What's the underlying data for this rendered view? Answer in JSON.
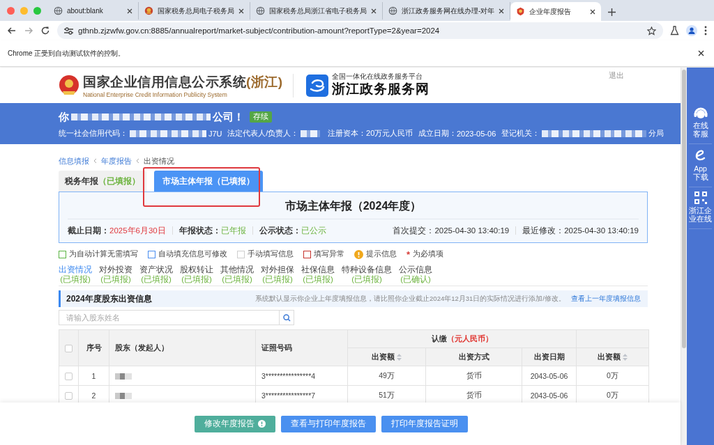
{
  "browser": {
    "tabs": [
      {
        "title": "about:blank",
        "selected": false
      },
      {
        "title": "国家税务总局电子税务局",
        "selected": false
      },
      {
        "title": "国家税务总局浙江省电子税务局",
        "selected": false
      },
      {
        "title": "浙江政务服务网在线办理-对年",
        "selected": false
      },
      {
        "title": "企业年度报告",
        "selected": true
      }
    ],
    "url": "gthnb.zjzwfw.gov.cn:8885/annualreport/market-subject/contribution-amount?reportType=2&year=2024",
    "infobar": "Chrome 正受到自动测试软件的控制。"
  },
  "header": {
    "logo_title": "国家企业信用信息公示系统",
    "logo_region": "(浙江)",
    "logo_subtitle": "National Enterprise Credit Information Publicity System",
    "portal_tagline": "全国一体化在线政务服务平台",
    "portal_name": "浙江政务服务网",
    "logout": "退出"
  },
  "company": {
    "greeting_start": "你",
    "greeting_end": "公司！",
    "status_badge": "存续",
    "fields": [
      {
        "label": "统一社会信用代码：",
        "redacted": true,
        "value": "J7U"
      },
      {
        "label": "法定代表人/负责人：",
        "redacted": true
      },
      {
        "label": "注册资本：",
        "redacted": false,
        "value": "20万元人民币"
      },
      {
        "label": "成立日期：",
        "redacted": false,
        "value": "2023-05-06"
      },
      {
        "label": "登记机关：",
        "redacted": true,
        "value": "分局"
      }
    ]
  },
  "breadcrumb": [
    {
      "label": "信息填报",
      "current": false
    },
    {
      "label": "年度报告",
      "current": false
    },
    {
      "label": "出资情况",
      "current": true
    }
  ],
  "report_tabs": [
    {
      "label": "税务年报",
      "status": "（已填报）",
      "selected": false
    },
    {
      "label": "市场主体年报",
      "status": "（已填报）",
      "selected": true
    }
  ],
  "summary": {
    "title": "市场主体年报（2024年度）",
    "statuses": [
      {
        "label": "截止日期：",
        "value": "2025年6月30日",
        "kind": "deadline"
      },
      {
        "label": "年报状态：",
        "value": "已年报",
        "kind": "done"
      },
      {
        "label": "公示状态：",
        "value": "已公示",
        "kind": "done"
      }
    ],
    "timestamps": [
      {
        "label": "首次提交：",
        "value": "2025-04-30 13:40:19"
      },
      {
        "label": "最近修改：",
        "value": "2025-04-30 13:40:19"
      }
    ]
  },
  "legend": [
    {
      "kind": "box",
      "color": "#5cb544",
      "label": "为自动计算无需填写"
    },
    {
      "kind": "box",
      "color": "#4a8ef0",
      "label": "自动填充信息可修改"
    },
    {
      "kind": "box",
      "color": "#cfcfcf",
      "label": "手动填写信息"
    },
    {
      "kind": "box",
      "color": "#c6332d",
      "label": "填写异常"
    },
    {
      "kind": "info",
      "label": "提示信息"
    },
    {
      "kind": "required",
      "mark": "*",
      "label": "为必填项"
    }
  ],
  "sections": [
    {
      "label": "出资情况",
      "status": "(已填报)",
      "selected": true
    },
    {
      "label": "对外投资",
      "status": "(已填报)",
      "selected": false
    },
    {
      "label": "资产状况",
      "status": "(已填报)",
      "selected": false
    },
    {
      "label": "股权转让",
      "status": "(已填报)",
      "selected": false
    },
    {
      "label": "其他情况",
      "status": "(已填报)",
      "selected": false
    },
    {
      "label": "对外担保",
      "status": "(已填报)",
      "selected": false
    },
    {
      "label": "社保信息",
      "status": "(已填报)",
      "selected": false
    },
    {
      "label": "特种设备信息",
      "status": "(已填报)",
      "selected": false
    },
    {
      "label": "公示信息",
      "status": "(已确认)",
      "selected": false
    }
  ],
  "panel": {
    "title": "2024年度股东出资信息",
    "notice": "系统默认显示你企业上年度填报信息，请比照你企业截止2024年12月31日的实际情况进行添加/修改。",
    "link": "查看上一年度填报信息"
  },
  "search": {
    "placeholder": "请输入股东姓名"
  },
  "table": {
    "all_checked": false,
    "columns": [
      "序号",
      "股东（发起人）",
      "证照号码"
    ],
    "group_label": "认缴",
    "group_unit": "（元人民币）",
    "subcolumns": [
      {
        "label": "出资额",
        "sortable": true
      },
      {
        "label": "出资方式",
        "sortable": false
      },
      {
        "label": "出资日期",
        "sortable": false
      },
      {
        "label": "出资额",
        "sortable": true
      }
    ],
    "rows": [
      {
        "checked": false,
        "index": "1",
        "name_redacted": true,
        "license": "3****************4",
        "amount": "49万",
        "method": "货币",
        "date": "2043-05-06",
        "paid": "0万"
      },
      {
        "checked": false,
        "index": "2",
        "name_redacted": true,
        "license": "3****************7",
        "amount": "51万",
        "method": "货币",
        "date": "2043-05-06",
        "paid": "0万"
      }
    ]
  },
  "buttons": [
    {
      "label": "修改年度报告",
      "kind": "secondary",
      "alert": true
    },
    {
      "label": "查看与打印年度报告",
      "kind": "primary",
      "alert": false
    },
    {
      "label": "打印年度报告证明",
      "kind": "primary",
      "alert": false
    }
  ],
  "side_rail": [
    {
      "label": "在线客服",
      "kind": "service"
    },
    {
      "label": "App下载",
      "kind": "app"
    },
    {
      "label": "浙江企业在线",
      "kind": "qr"
    }
  ]
}
